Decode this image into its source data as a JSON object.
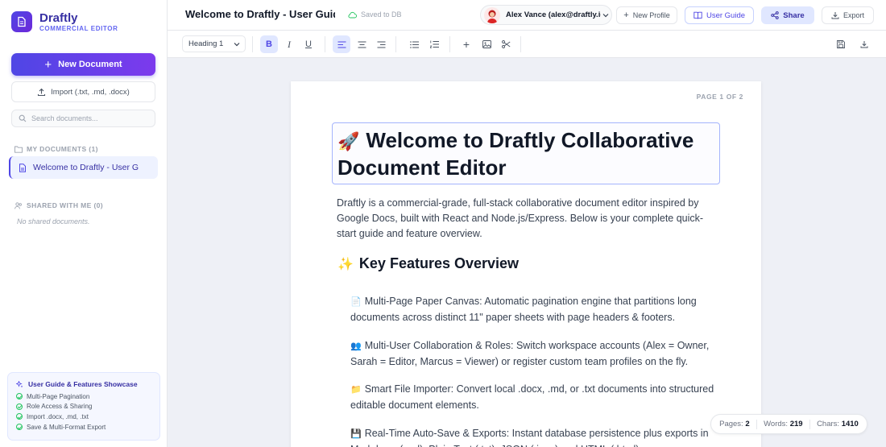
{
  "brand": {
    "name": "Draftly",
    "subtitle": "COMMERCIAL EDITOR"
  },
  "sidebar": {
    "new_document_label": "New Document",
    "import_label": "Import (.txt, .md, .docx)",
    "search_placeholder": "Search documents...",
    "my_documents_header": "MY DOCUMENTS (1)",
    "documents": [
      {
        "title": "Welcome to Draftly - User G"
      }
    ],
    "shared_header": "SHARED WITH ME (0)",
    "shared_empty": "No shared documents.",
    "guide": {
      "title": "User Guide & Features Showcase",
      "items": [
        "Multi-Page Pagination",
        "Role Access & Sharing",
        "Import .docx, .md, .txt",
        "Save & Multi-Format Export"
      ]
    }
  },
  "header": {
    "doc_title": "Welcome to Draftly - User Guide",
    "save_status": "Saved to DB",
    "user": "Alex Vance (alex@draftly.io)",
    "new_profile_label": "New Profile",
    "user_guide_label": "User Guide",
    "share_label": "Share",
    "export_label": "Export"
  },
  "toolbar": {
    "block_style": "Heading 1",
    "bold_glyph": "B",
    "italic_glyph": "I",
    "underline_glyph": "U"
  },
  "page": {
    "page_indicator": "PAGE 1 OF 2",
    "heading_emoji": "🚀",
    "heading": "Welcome to Draftly Collaborative Document Editor",
    "intro": "Draftly is a commercial-grade, full-stack collaborative document editor inspired by Google Docs, built with React and Node.js/Express. Below is your complete quick-start guide and feature overview.",
    "section_emoji": "✨",
    "section_title": "Key Features Overview",
    "features": [
      {
        "emoji": "📄",
        "text": "Multi-Page Paper Canvas: Automatic pagination engine that partitions long documents across distinct 11\" paper sheets with page headers & footers."
      },
      {
        "emoji": "👥",
        "text": "Multi-User Collaboration & Roles: Switch workspace accounts (Alex = Owner, Sarah = Editor, Marcus = Viewer) or register custom team profiles on the fly."
      },
      {
        "emoji": "📁",
        "text": "Smart File Importer: Convert local .docx, .md, or .txt documents into structured editable document elements."
      },
      {
        "emoji": "💾",
        "text": "Real-Time Auto-Save & Exports: Instant database persistence plus exports in Markdown (.md), Plain Text (.txt), JSON (.json) and HTML (.html)."
      }
    ]
  },
  "status": {
    "pages_label": "Pages:",
    "pages_value": "2",
    "words_label": "Words:",
    "words_value": "219",
    "chars_label": "Chars:",
    "chars_value": "1410"
  },
  "colors": {
    "accent": "#4f46e5",
    "accent_soft": "#e0e7ff",
    "canvas_bg": "#eef0f6",
    "success": "#22c55e"
  }
}
